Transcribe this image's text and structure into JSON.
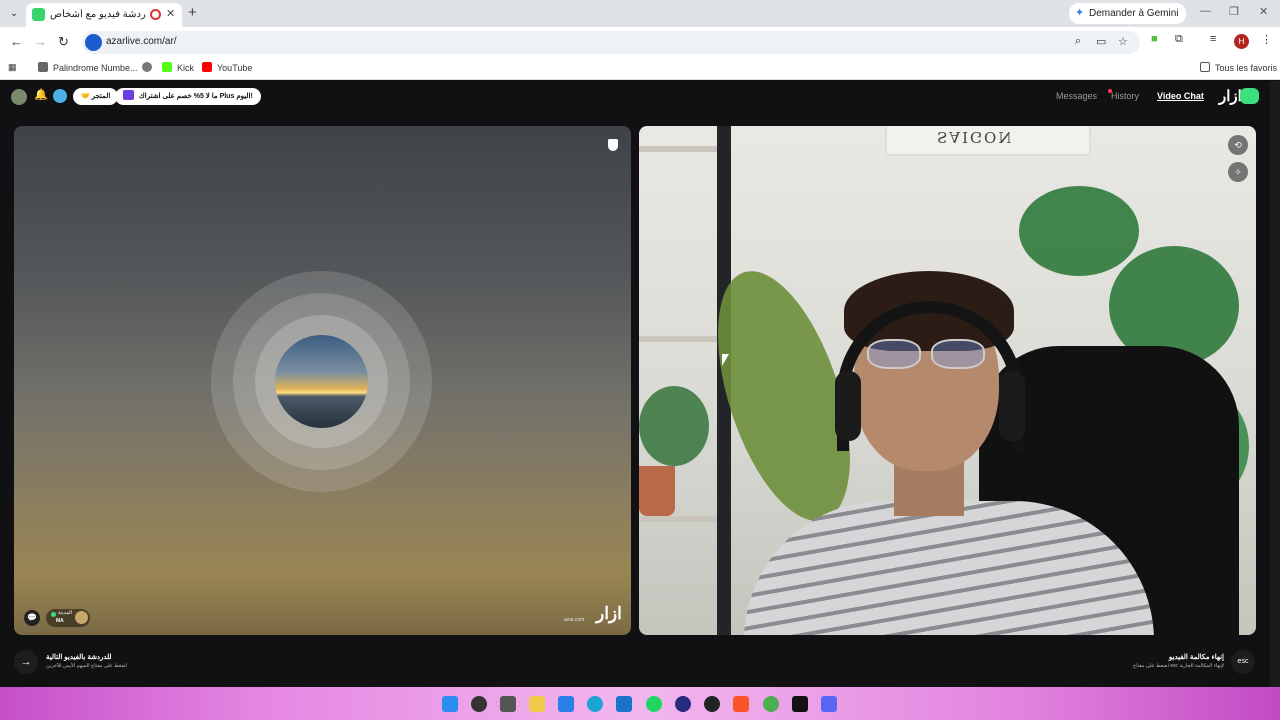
{
  "browser": {
    "tab_title": "أزار: دردشة فيديو مع أشخاص",
    "tab_close": "✕",
    "new_tab": "+",
    "gemini_label": "Demander à Gemini",
    "url": "azarlive.com/ar/",
    "bookmarks": [
      {
        "label": "Palindrome Numbe...",
        "color": "#444"
      },
      {
        "label": "",
        "color": "#555"
      },
      {
        "label": "Kick",
        "color": "#53fc18"
      },
      {
        "label": "YouTube",
        "color": "#ff0000"
      }
    ],
    "all_bookmarks": "Tous les favoris",
    "profile_initial": "H"
  },
  "azar": {
    "pill_store": "🤝 المتجر",
    "pill_promo": "ما لا 5% خصم على اشتراك Plus اليوم!",
    "nav": {
      "messages": "Messages",
      "history": "History",
      "video_chat": "Video Chat"
    },
    "brand": "ازار",
    "left_panel": {
      "location_name": "المدينة",
      "location_country": "MA",
      "watermark": "ازار",
      "watermark_id": "azar.com"
    },
    "right_panel": {
      "frame_text": "SAIGON"
    },
    "bottom_left": {
      "title": "للدردشة بالفيديو التالية",
      "subtitle": "اضغط على مفتاح السهم الأيمن للآخرين"
    },
    "bottom_right": {
      "title": "إنهاء مكالمة الفيديو",
      "subtitle": "اضغط على مفتاح esc لإنهاء المكالمة الجارية",
      "esc_label": "esc"
    }
  },
  "colors": {
    "brand_green": "#3ce07c",
    "accent_red": "#ff3b52"
  }
}
